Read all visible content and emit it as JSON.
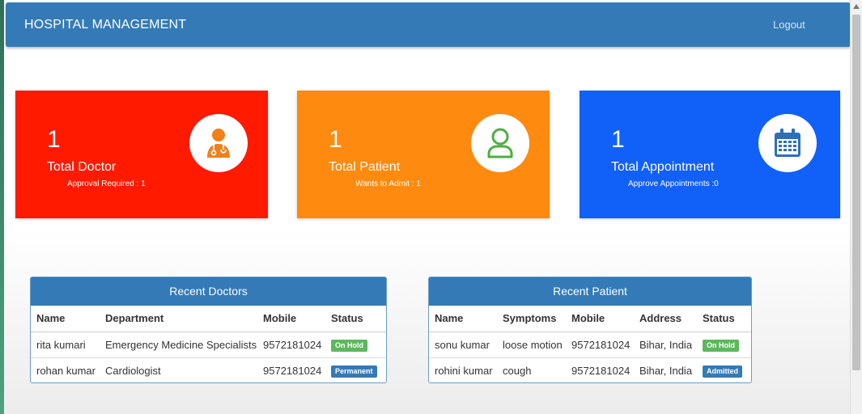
{
  "navbar": {
    "brand": "HOSPITAL MANAGEMENT",
    "logout": "Logout"
  },
  "cards": {
    "doctor": {
      "count": "1",
      "title": "Total Doctor",
      "sub": "Approval Required : 1",
      "icon": "doctor-icon"
    },
    "patient": {
      "count": "1",
      "title": "Total Patient",
      "sub": "Wants to Admit : 1",
      "icon": "user-icon"
    },
    "appointment": {
      "count": "1",
      "title": "Total Appointment",
      "sub": "Approve Appointments :0",
      "icon": "calendar-icon"
    }
  },
  "colors": {
    "doctor": "#ff1a00",
    "patient": "#ff8a10",
    "appointment": "#1160f8",
    "primary": "#337ab7",
    "success": "#5cb85c"
  },
  "recent_doctors": {
    "heading": "Recent Doctors",
    "columns": [
      "Name",
      "Department",
      "Mobile",
      "Status"
    ],
    "rows": [
      [
        "rita kumari",
        "Emergency Medicine Specialists",
        "9572181024",
        "On Hold"
      ],
      [
        "rohan kumar",
        "Cardiologist",
        "9572181024",
        "Permanent"
      ]
    ]
  },
  "recent_patient": {
    "heading": "Recent Patient",
    "columns": [
      "Name",
      "Symptoms",
      "Mobile",
      "Address",
      "Status"
    ],
    "rows": [
      [
        "sonu kumar",
        "loose motion",
        "9572181024",
        "Bihar, India",
        "On Hold"
      ],
      [
        "rohini kumar",
        "cough",
        "9572181024",
        "Bihar, India",
        "Admitted"
      ]
    ]
  }
}
